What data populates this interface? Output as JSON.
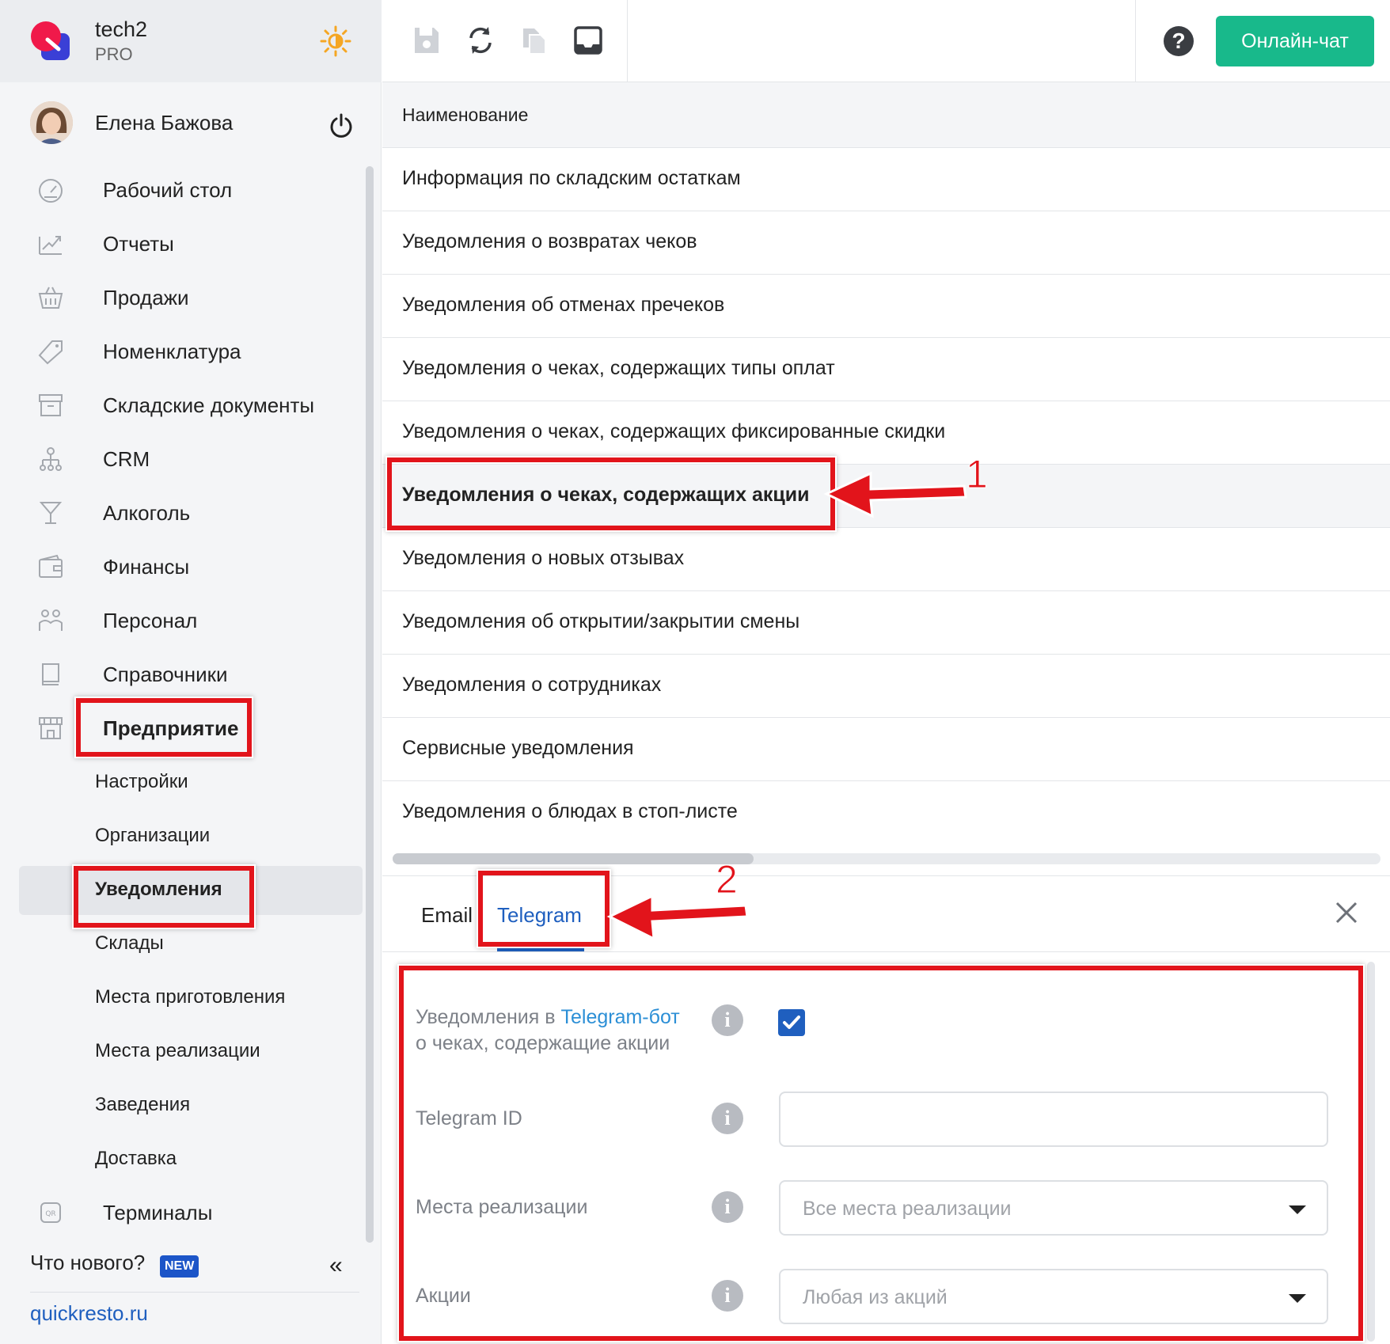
{
  "brand": {
    "name": "tech2",
    "plan": "PRO"
  },
  "user": {
    "name": "Елена Бажова"
  },
  "menu": {
    "items": [
      {
        "label": "Рабочий стол",
        "icon": "dashboard-icon"
      },
      {
        "label": "Отчеты",
        "icon": "reports-icon"
      },
      {
        "label": "Продажи",
        "icon": "basket-icon"
      },
      {
        "label": "Номенклатура",
        "icon": "tag-icon"
      },
      {
        "label": "Складские документы",
        "icon": "archive-icon"
      },
      {
        "label": "CRM",
        "icon": "crm-icon"
      },
      {
        "label": "Алкоголь",
        "icon": "cocktail-icon"
      },
      {
        "label": "Финансы",
        "icon": "wallet-icon"
      },
      {
        "label": "Персонал",
        "icon": "people-icon"
      },
      {
        "label": "Справочники",
        "icon": "book-icon"
      },
      {
        "label": "Предприятие",
        "icon": "store-icon"
      }
    ],
    "enterprise_sub": [
      "Настройки",
      "Организации",
      "Уведомления",
      "Склады",
      "Места приготовления",
      "Места реализации",
      "Заведения",
      "Доставка"
    ],
    "terminals": "Терминалы"
  },
  "footer": {
    "whats_new": "Что нового?",
    "new_badge": "NEW",
    "collapse": "«",
    "site": "quickresto.ru"
  },
  "topbar": {
    "help": "?",
    "chat_button": "Онлайн-чат"
  },
  "table": {
    "header": "Наименование",
    "rows": [
      "Информация по складским остаткам",
      "Уведомления о возвратах чеков",
      "Уведомления об отменах пречеков",
      "Уведомления о чеках, содержащих типы оплат",
      "Уведомления о чеках, содержащих фиксированные скидки",
      "Уведомления о чеках, содержащих акции",
      "Уведомления о новых отзывах",
      "Уведомления об открытии/закрытии смены",
      "Уведомления о сотрудниках",
      "Сервисные уведомления",
      "Уведомления о блюдах в стоп-листе"
    ],
    "selected_index": 5
  },
  "panel": {
    "tabs": [
      "Email",
      "Telegram"
    ],
    "active_tab": "Telegram",
    "form": {
      "notify_label_prefix": "Уведомления в ",
      "notify_label_link": "Telegram-бот",
      "notify_label_suffix": "о чеках, содержащие акции",
      "notify_checked": true,
      "telegram_id_label": "Telegram ID",
      "telegram_id_value": "",
      "places_label": "Места реализации",
      "places_value": "Все места реализации",
      "promos_label": "Акции",
      "promos_value": "Любая из акций",
      "info": "i"
    }
  },
  "annotations": {
    "one": "1",
    "two": "2",
    "color": "#e2141b"
  },
  "colors": {
    "accent": "#1f5fbf",
    "chat_green": "#18b98b",
    "sidebar_bg": "#f4f5f7"
  }
}
